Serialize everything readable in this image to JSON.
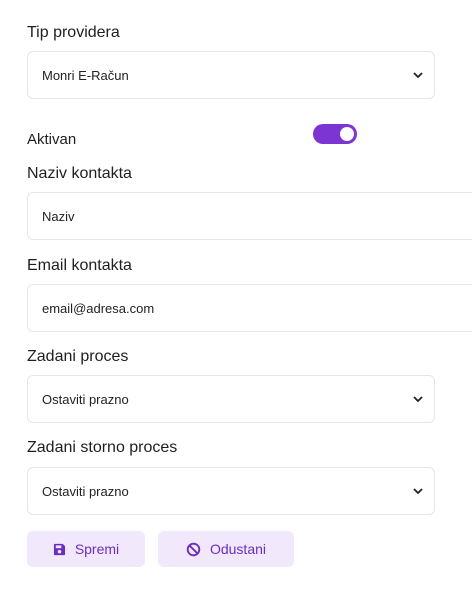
{
  "form": {
    "provider_type": {
      "label": "Tip providera",
      "value": "Monri E-Račun"
    },
    "active": {
      "label": "Aktivan",
      "enabled": true
    },
    "contact_name": {
      "label": "Naziv kontakta",
      "placeholder": "Naziv"
    },
    "contact_email": {
      "label": "Email kontakta",
      "placeholder": "email@adresa.com"
    },
    "default_process": {
      "label": "Zadani proces",
      "value": "Ostaviti prazno"
    },
    "default_storno_process": {
      "label": "Zadani storno proces",
      "value": "Ostaviti prazno"
    }
  },
  "actions": {
    "save_label": "Spremi",
    "cancel_label": "Odustani"
  },
  "colors": {
    "accent": "#7c34d2",
    "button_bg": "#f1e9fb",
    "button_text": "#6b2ec0"
  },
  "icons": {
    "save": "floppy-disk-icon",
    "cancel": "ban-icon",
    "select": "chevron-down-icon"
  }
}
